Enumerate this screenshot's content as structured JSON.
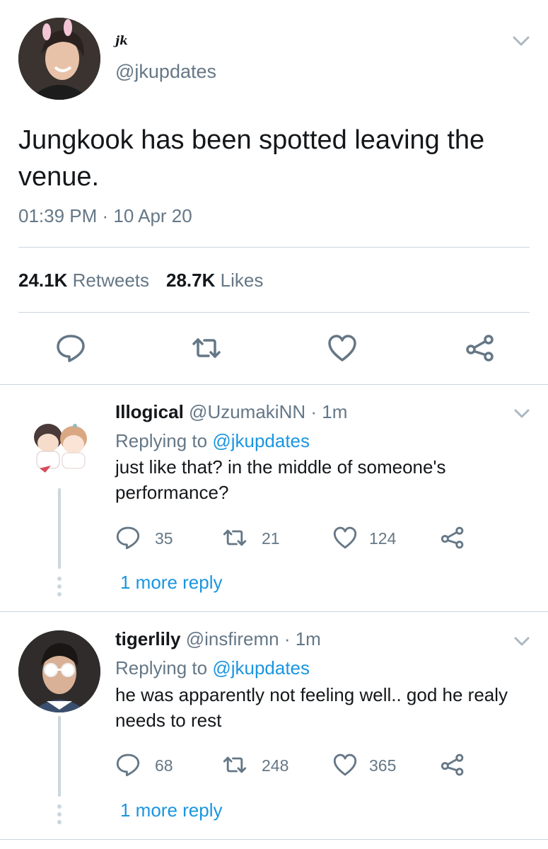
{
  "tweet": {
    "display_name": "jk",
    "handle": "@jkupdates",
    "text": "Jungkook has been spotted leaving the venue.",
    "timestamp": "01:39 PM · 10 Apr 20",
    "retweets_count": "24.1K",
    "retweets_label": "Retweets",
    "likes_count": "28.7K",
    "likes_label": "Likes",
    "actions": [
      "reply-icon",
      "retweet-icon",
      "like-icon",
      "share-icon"
    ]
  },
  "replies": [
    {
      "name": "Illogical",
      "handle": "@UzumakiNN",
      "time": "· 1m",
      "replying_prefix": "Replying to",
      "replying_to": "@jkupdates",
      "text": "just like that? in the middle of someone's performance?",
      "replies_count": "35",
      "retweets_count": "21",
      "likes_count": "124",
      "more_label": "1 more reply"
    },
    {
      "name": "tigerlily",
      "handle": "@insfiremn",
      "time": "· 1m",
      "replying_prefix": "Replying to",
      "replying_to": "@jkupdates",
      "text": "he was apparently not feeling well.. god he realy needs to rest",
      "replies_count": "68",
      "retweets_count": "248",
      "likes_count": "365",
      "more_label": "1 more reply"
    }
  ],
  "colors": {
    "secondary_text": "#657786",
    "link": "#1b95e0",
    "divider": "#ccd6dd"
  }
}
